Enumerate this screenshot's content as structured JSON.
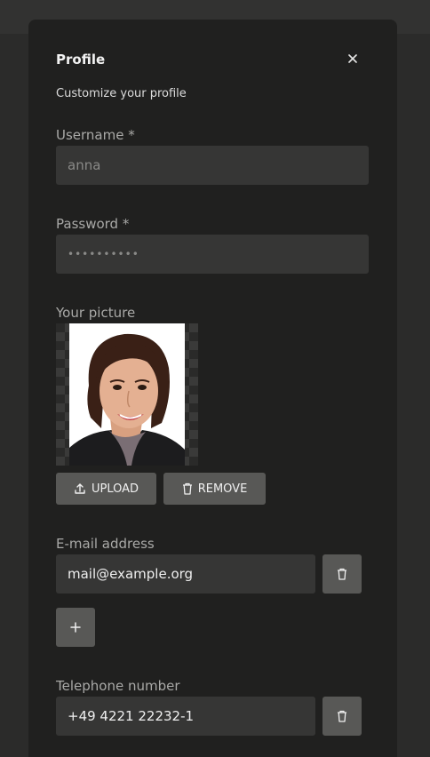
{
  "dialog": {
    "title": "Profile",
    "subtitle": "Customize your profile"
  },
  "fields": {
    "username": {
      "label": "Username *",
      "value": "anna"
    },
    "password": {
      "label": "Password *",
      "value": "••••••••••"
    },
    "picture": {
      "label": "Your picture",
      "upload_label": "UPLOAD",
      "remove_label": "REMOVE"
    },
    "email": {
      "label": "E-mail address",
      "value": "mail@example.org"
    },
    "phone": {
      "label": "Telephone number",
      "value": "+49 4221 22232-1"
    }
  },
  "icons": {
    "close": "close-icon",
    "upload": "upload-icon",
    "trash": "trash-icon",
    "add": "plus-icon"
  },
  "colors": {
    "dialog_bg": "#20201f",
    "input_bg": "#363635",
    "button_bg": "#585856"
  }
}
